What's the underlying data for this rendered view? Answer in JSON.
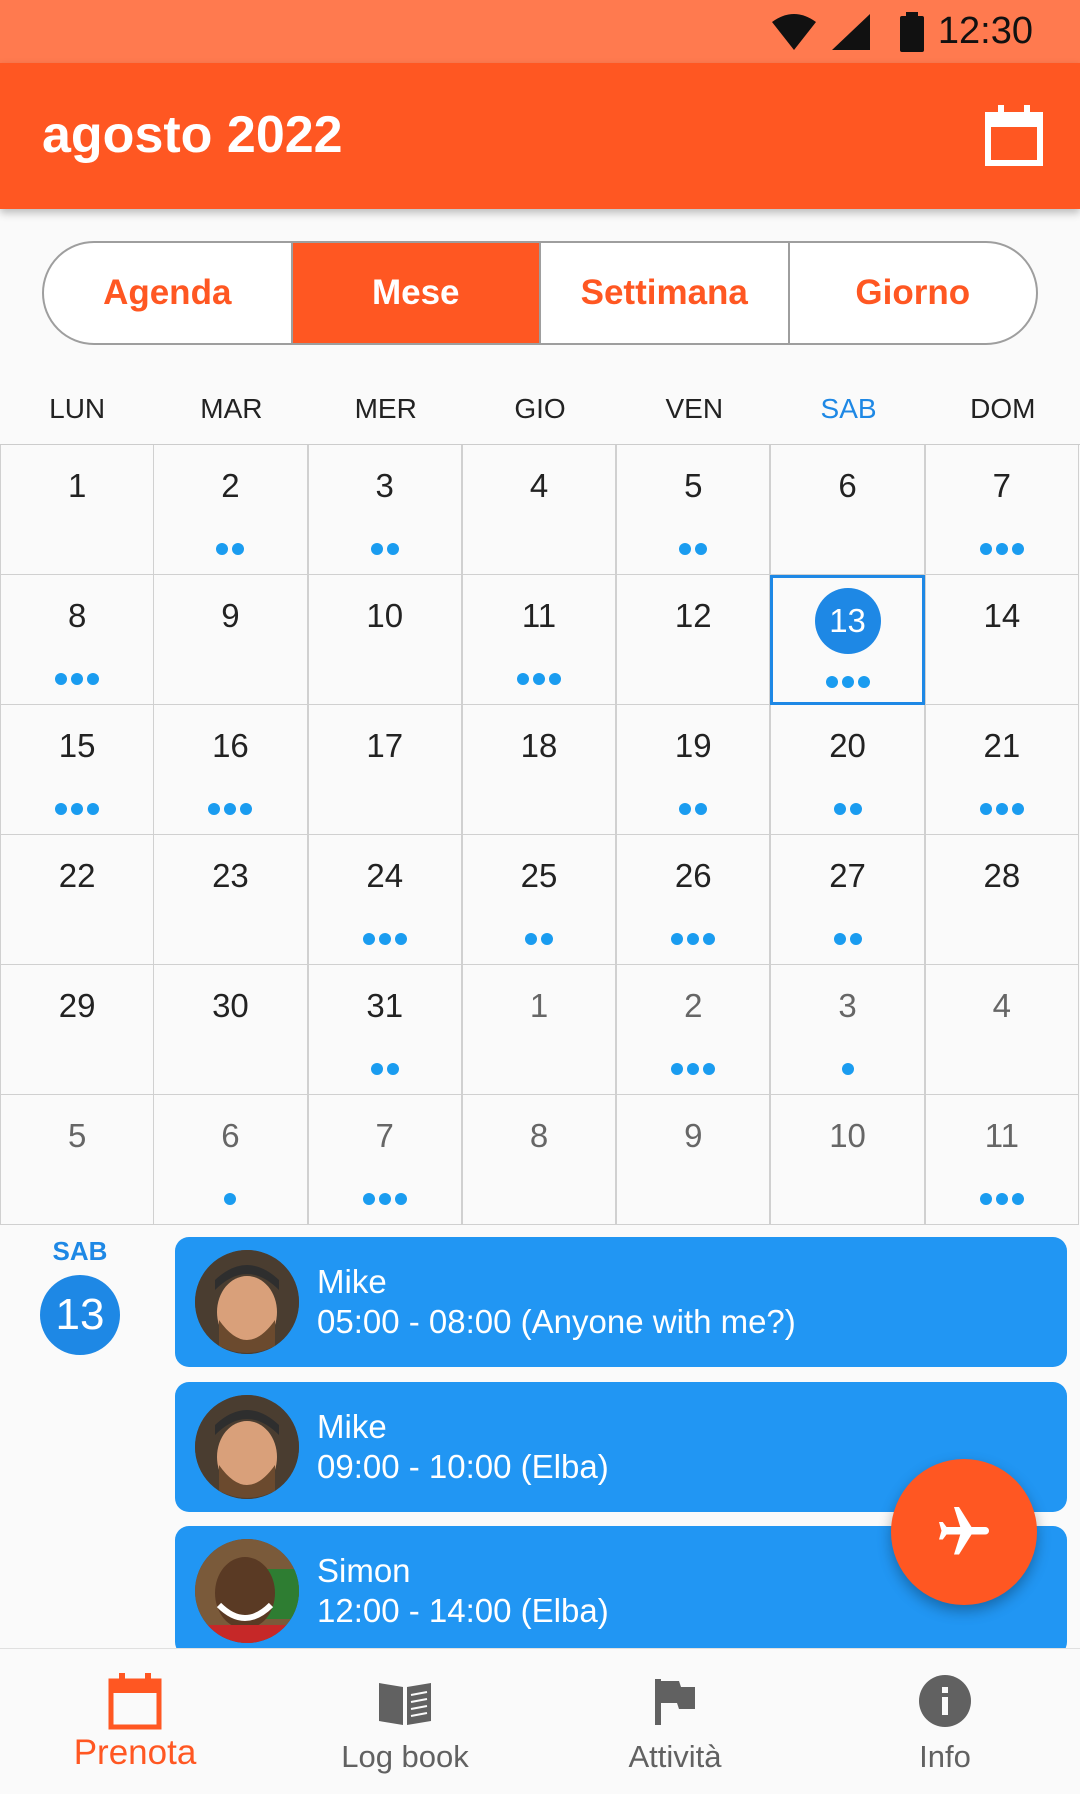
{
  "status_bar": {
    "time": "12:30",
    "icons": [
      "wifi-icon",
      "signal-icon",
      "battery-icon"
    ]
  },
  "app_bar": {
    "title": "agosto 2022",
    "action_icon": "calendar-icon"
  },
  "view_tabs": [
    {
      "label": "Agenda",
      "active": false
    },
    {
      "label": "Mese",
      "active": true
    },
    {
      "label": "Settimana",
      "active": false
    },
    {
      "label": "Giorno",
      "active": false
    }
  ],
  "weekdays": [
    "LUN",
    "MAR",
    "MER",
    "GIO",
    "VEN",
    "SAB",
    "DOM"
  ],
  "calendar": {
    "selected_day": "13",
    "weeks": [
      [
        {
          "d": "1",
          "dots": 0,
          "out": false
        },
        {
          "d": "2",
          "dots": 2,
          "out": false
        },
        {
          "d": "3",
          "dots": 2,
          "out": false
        },
        {
          "d": "4",
          "dots": 0,
          "out": false
        },
        {
          "d": "5",
          "dots": 2,
          "out": false
        },
        {
          "d": "6",
          "dots": 0,
          "out": false
        },
        {
          "d": "7",
          "dots": 3,
          "out": false
        }
      ],
      [
        {
          "d": "8",
          "dots": 3,
          "out": false
        },
        {
          "d": "9",
          "dots": 0,
          "out": false
        },
        {
          "d": "10",
          "dots": 0,
          "out": false
        },
        {
          "d": "11",
          "dots": 3,
          "out": false
        },
        {
          "d": "12",
          "dots": 0,
          "out": false
        },
        {
          "d": "13",
          "dots": 3,
          "out": false,
          "selected": true
        },
        {
          "d": "14",
          "dots": 0,
          "out": false
        }
      ],
      [
        {
          "d": "15",
          "dots": 3,
          "out": false
        },
        {
          "d": "16",
          "dots": 3,
          "out": false
        },
        {
          "d": "17",
          "dots": 0,
          "out": false
        },
        {
          "d": "18",
          "dots": 0,
          "out": false
        },
        {
          "d": "19",
          "dots": 2,
          "out": false
        },
        {
          "d": "20",
          "dots": 2,
          "out": false
        },
        {
          "d": "21",
          "dots": 3,
          "out": false
        }
      ],
      [
        {
          "d": "22",
          "dots": 0,
          "out": false
        },
        {
          "d": "23",
          "dots": 0,
          "out": false
        },
        {
          "d": "24",
          "dots": 3,
          "out": false
        },
        {
          "d": "25",
          "dots": 2,
          "out": false
        },
        {
          "d": "26",
          "dots": 3,
          "out": false
        },
        {
          "d": "27",
          "dots": 2,
          "out": false
        },
        {
          "d": "28",
          "dots": 0,
          "out": false
        }
      ],
      [
        {
          "d": "29",
          "dots": 0,
          "out": false
        },
        {
          "d": "30",
          "dots": 0,
          "out": false
        },
        {
          "d": "31",
          "dots": 2,
          "out": false
        },
        {
          "d": "1",
          "dots": 0,
          "out": true
        },
        {
          "d": "2",
          "dots": 3,
          "out": true
        },
        {
          "d": "3",
          "dots": 1,
          "out": true
        },
        {
          "d": "4",
          "dots": 0,
          "out": true
        }
      ],
      [
        {
          "d": "5",
          "dots": 0,
          "out": true
        },
        {
          "d": "6",
          "dots": 1,
          "out": true
        },
        {
          "d": "7",
          "dots": 3,
          "out": true
        },
        {
          "d": "8",
          "dots": 0,
          "out": true
        },
        {
          "d": "9",
          "dots": 0,
          "out": true
        },
        {
          "d": "10",
          "dots": 0,
          "out": true
        },
        {
          "d": "11",
          "dots": 3,
          "out": true
        }
      ]
    ]
  },
  "day_badge": {
    "weekday": "SAB",
    "day": "13"
  },
  "events": [
    {
      "name": "Mike",
      "time": "05:00 - 08:00 (Anyone with me?)"
    },
    {
      "name": "Mike",
      "time": "09:00 - 10:00 (Elba)"
    },
    {
      "name": "Simon",
      "time": "12:00 - 14:00 (Elba)"
    }
  ],
  "fab": {
    "icon": "airplane-icon"
  },
  "bottom_nav": [
    {
      "label": "Prenota",
      "icon": "calendar-icon",
      "active": true
    },
    {
      "label": "Log book",
      "icon": "book-icon",
      "active": false
    },
    {
      "label": "Attività",
      "icon": "flag-icon",
      "active": false
    },
    {
      "label": "Info",
      "icon": "info-icon",
      "active": false
    }
  ],
  "colors": {
    "primary": "#ff5722",
    "status_bar": "#ff7a4f",
    "accent_blue": "#2196f3",
    "dot_blue": "#1a9cf0"
  }
}
